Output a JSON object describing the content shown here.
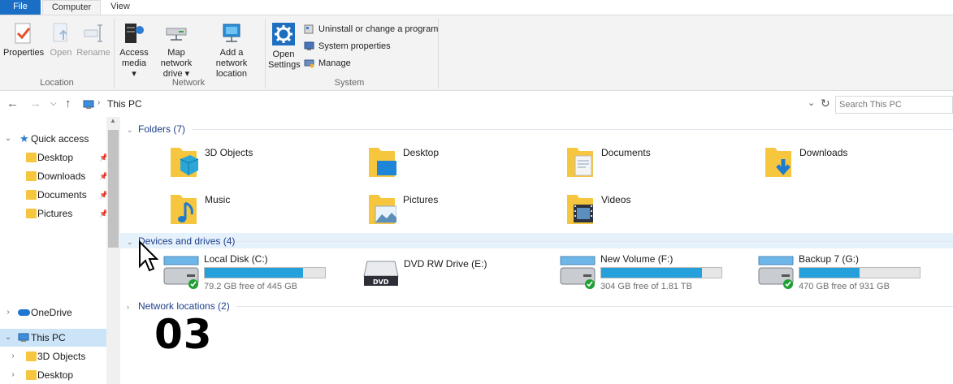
{
  "tabs": {
    "file": "File",
    "computer": "Computer",
    "view": "View"
  },
  "ribbon": {
    "location": {
      "label": "Location",
      "properties": "Properties",
      "open": "Open",
      "rename": "Rename"
    },
    "network": {
      "label": "Network",
      "access_media": "Access media ▾",
      "map_drive": "Map network drive ▾",
      "add_location": "Add a network location"
    },
    "system": {
      "label": "System",
      "open_settings": "Open Settings",
      "uninstall": "Uninstall or change a program",
      "system_properties": "System properties",
      "manage": "Manage"
    }
  },
  "address": {
    "path": "This PC",
    "search_placeholder": "Search This PC"
  },
  "nav": {
    "quick_access": "Quick access",
    "desktop": "Desktop",
    "downloads": "Downloads",
    "documents": "Documents",
    "pictures": "Pictures",
    "onedrive": "OneDrive",
    "this_pc": "This PC",
    "objects3d": "3D Objects",
    "desktop2": "Desktop"
  },
  "sections": {
    "folders": "Folders (7)",
    "devices": "Devices and drives (4)",
    "network": "Network locations (2)"
  },
  "folders": [
    {
      "label": "3D Objects"
    },
    {
      "label": "Desktop"
    },
    {
      "label": "Documents"
    },
    {
      "label": "Downloads"
    },
    {
      "label": "Music"
    },
    {
      "label": "Pictures"
    },
    {
      "label": "Videos"
    }
  ],
  "drives": [
    {
      "label": "Local Disk (C:)",
      "free": "79.2 GB free of 445 GB",
      "used_fraction": 0.82
    },
    {
      "label": "DVD RW Drive (E:)"
    },
    {
      "label": "New Volume (F:)",
      "free": "304 GB free of 1.81 TB",
      "used_fraction": 0.84
    },
    {
      "label": "Backup 7 (G:)",
      "free": "470 GB free of 931 GB",
      "used_fraction": 0.5
    }
  ],
  "overlay_text": "03",
  "colors": {
    "accent": "#1a6fc4",
    "bar_fill": "#26a0da",
    "selection": "#cce4f7",
    "folder": "#f6c63f"
  }
}
